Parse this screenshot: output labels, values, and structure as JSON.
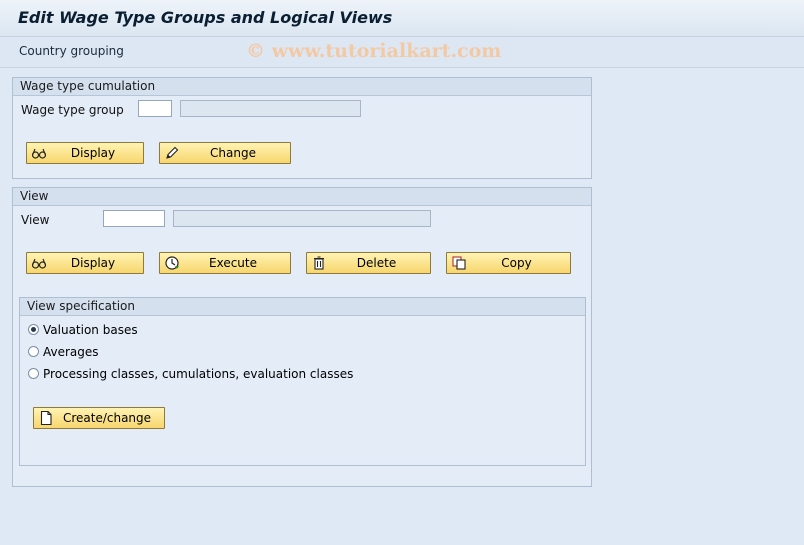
{
  "window": {
    "title": "Edit Wage Type Groups and Logical Views"
  },
  "toolbar": {
    "country_grouping": "Country grouping",
    "watermark": "© www.tutorialkart.com"
  },
  "wage_type_cumulation": {
    "header": "Wage type cumulation",
    "field_label": "Wage type group",
    "field_value": "",
    "description_value": "",
    "display_label": "Display",
    "change_label": "Change"
  },
  "view": {
    "header": "View",
    "field_label": "View",
    "field_value": "",
    "description_value": "",
    "display_label": "Display",
    "execute_label": "Execute",
    "delete_label": "Delete",
    "copy_label": "Copy"
  },
  "view_specification": {
    "header": "View specification",
    "options": [
      {
        "label": "Valuation bases",
        "selected": true
      },
      {
        "label": "Averages",
        "selected": false
      },
      {
        "label": "Processing classes, cumulations, evaluation classes",
        "selected": false
      }
    ],
    "create_change_label": "Create/change"
  },
  "icons": {
    "display": "glasses-icon",
    "change": "pencil-icon",
    "execute": "clock-execute-icon",
    "delete": "trash-icon",
    "copy": "copy-icon",
    "create": "blank-document-icon"
  },
  "colors": {
    "background": "#dfe9f5",
    "button": "#f7d66d",
    "group_header": "#d4e0ee"
  }
}
